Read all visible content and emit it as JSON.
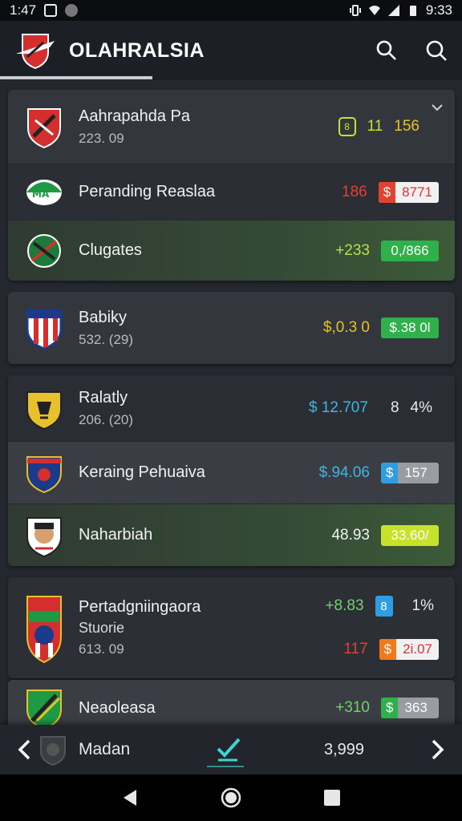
{
  "status_bar": {
    "time": "1:47",
    "right_time": "9:33"
  },
  "app": {
    "title": "OLAHRALSIA",
    "accent": "#d32f2f"
  },
  "rows": {
    "r1": {
      "name": "Aahrapahda Pa",
      "sub": "223. 09",
      "v1": "11",
      "v2": "156"
    },
    "r2": {
      "name": "Peranding Reaslaa",
      "val": "186",
      "chip_tag": "$",
      "chip_num": "8771"
    },
    "r3": {
      "name": "Clugates",
      "val": "+233",
      "chip": "0,/866"
    },
    "r4": {
      "name": "Babiky",
      "sub": "532. (29)",
      "val": "$,0.3 0",
      "chip": "$.38 0l"
    },
    "r5": {
      "name": "Ralatly",
      "sub": "206. (20)",
      "val": "$ 12.707",
      "v2": "8",
      "v3": "4%"
    },
    "r6": {
      "name": "Keraing Pehuaiva",
      "val": "$.94.06",
      "chip_tag": "$",
      "chip_num": "157"
    },
    "r7": {
      "name": "Naharbiah",
      "val": "48.93",
      "chip": "33.60/"
    },
    "r8": {
      "name": "Pertadgniingaora",
      "name2": "Stuorie",
      "sub": "613. 09",
      "val": "+8.83",
      "box": "8",
      "pct": "1%",
      "val2": "117",
      "chip_tag": "$",
      "chip_num": "2i.07"
    },
    "r9": {
      "name": "Neaoleasa",
      "val": "+310",
      "chip_tag": "$",
      "chip_num": "363"
    }
  },
  "bottom": {
    "name": "Madan",
    "value": "3,999"
  },
  "colors": {
    "green": "#2fb04a",
    "red": "#e2422f",
    "blue": "#2f9de0",
    "lime": "#c6e22a",
    "orange": "#f07a1a"
  }
}
